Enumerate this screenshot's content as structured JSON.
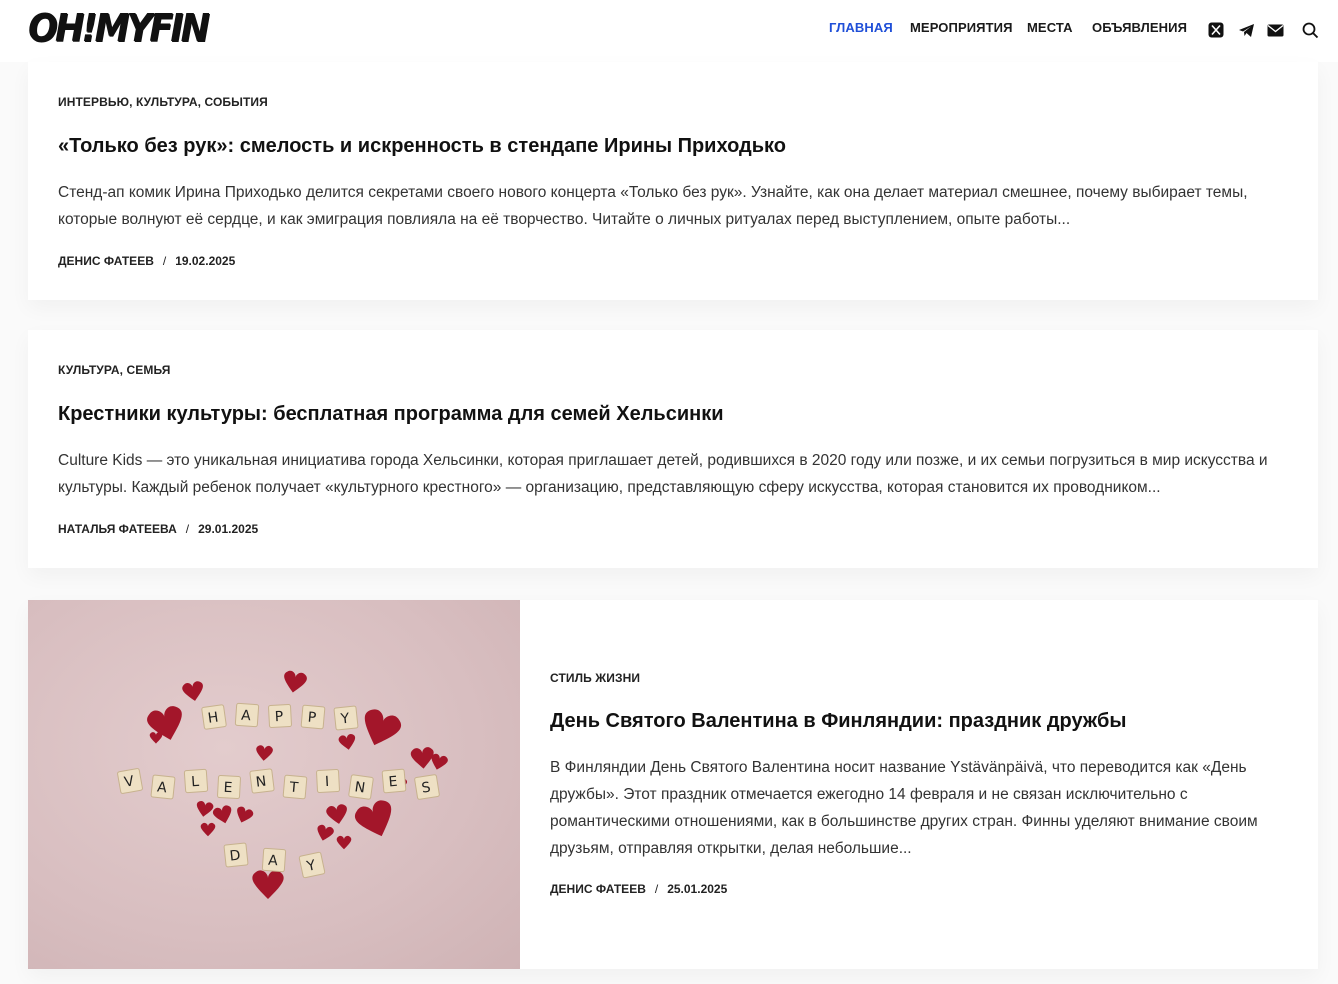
{
  "site": {
    "logo": "OH!MYFIN"
  },
  "nav": {
    "items": [
      {
        "label": "ГЛАВНАЯ",
        "active": true
      },
      {
        "label": "МЕРОПРИЯТИЯ",
        "active": false
      },
      {
        "label": "МЕСТА",
        "active": false
      },
      {
        "label": "ОБЪЯВЛЕНИЯ",
        "active": false
      }
    ]
  },
  "header_icons": [
    "x-twitter-icon",
    "telegram-icon",
    "mail-icon",
    "search-icon"
  ],
  "colors": {
    "accent": "#1f4fd8",
    "text": "#111111",
    "background": "#fafafa"
  },
  "posts": [
    {
      "categories": "ИНТЕРВЬЮ, КУЛЬТУРА, СОБЫТИЯ",
      "title": "«Только без рук»: смелость и искренность в стендапе Ирины Приходько",
      "excerpt": "Стенд-ап комик Ирина Приходько делится секретами своего нового концерта «Только без рук». Узнайте, как она делает материал смешнее, почему выбирает темы, которые волнуют её сердце, и как эмиграция повлияла на её творчество. Читайте о личных ритуалах перед выступлением, опыте работы...",
      "author": "ДЕНИС ФАТЕЕВ",
      "date": "19.02.2025"
    },
    {
      "categories": "КУЛЬТУРА, СЕМЬЯ",
      "title": "Крестники культуры: бесплатная программа для семей Хельсинки",
      "excerpt": "Culture Kids — это уникальная инициатива города Хельсинки, которая приглашает детей, родившихся в 2020 году или позже, и их семьи погрузиться в мир искусства и культуры. Каждый ребенок получает «культурного крестного» — организацию, представляющую сферу искусства, которая становится их проводником...",
      "author": "НАТАЛЬЯ ФАТЕЕВА",
      "date": "29.01.2025"
    },
    {
      "categories": "СТИЛЬ ЖИЗНИ",
      "title": "День Святого Валентина в Финляндии: праздник дружбы",
      "excerpt": "В Финляндии День Святого Валентина носит название Ystävänpäivä, что переводится как «День дружбы». Этот праздник отмечается ежегодно 14 февраля и не связан исключительно с романтическими отношениями, как в большинстве других стран. Финны уделяют внимание своим друзьям, отправляя открытки, делая небольшие...",
      "author": "ДЕНИС ФАТЕЕВ",
      "date": "25.01.2025",
      "image_tiles": {
        "row1": [
          "H",
          "A",
          "P",
          "P",
          "Y"
        ],
        "row2": [
          "V",
          "A",
          "L",
          "E",
          "N",
          "T",
          "I",
          "N",
          "E",
          "S"
        ],
        "row3": [
          "D",
          "A",
          "Y"
        ]
      }
    }
  ],
  "meta_separator": "/"
}
